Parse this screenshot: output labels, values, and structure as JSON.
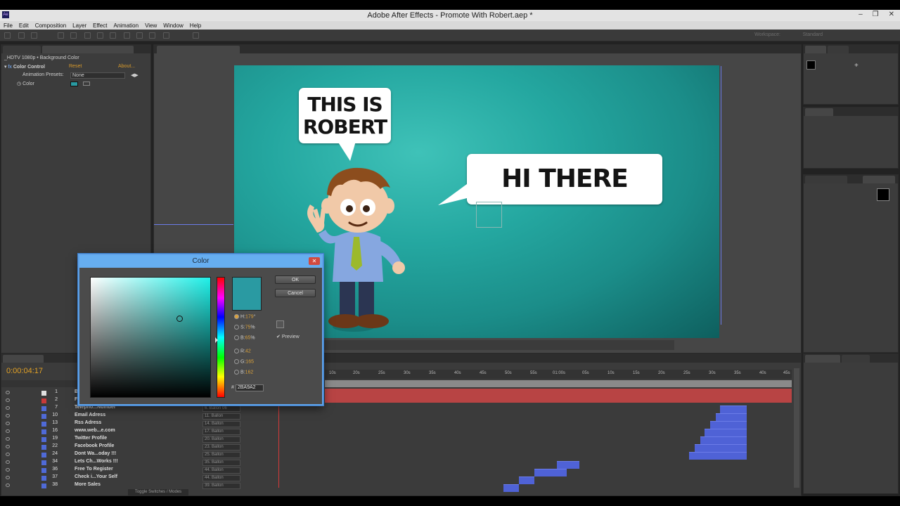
{
  "window": {
    "title": "Adobe After Effects - Promote With Robert.aep *",
    "app_icon": "Ae"
  },
  "menu": [
    "File",
    "Edit",
    "Composition",
    "Layer",
    "Effect",
    "Animation",
    "View",
    "Window",
    "Help"
  ],
  "effect_controls": {
    "breadcrumb": "_HDTV 1080p • Background Color",
    "effect_name": "Color Control",
    "reset": "Reset",
    "about": "About...",
    "presets_label": "Animation Presets:",
    "presets_value": "None",
    "color_label": "Color",
    "color_value": "#2A9AA2"
  },
  "canvas": {
    "bubble_left": [
      "THIS IS",
      "ROBERT"
    ],
    "bubble_right": "HI THERE"
  },
  "color_dialog": {
    "title": "Color",
    "ok": "OK",
    "cancel": "Cancel",
    "h_label": "H:",
    "h_value": "179",
    "h_unit": "°",
    "s_label": "S:",
    "s_value": "75",
    "s_unit": "%",
    "b_label": "B:",
    "b_value": "65",
    "b_unit": "%",
    "r_label": "R:",
    "r_value": "42",
    "g_label": "G:",
    "g_value": "165",
    "bl_label": "B:",
    "bl_value": "162",
    "hex_label": "#",
    "hex_value": "2BA9A2",
    "preview_label": "Preview",
    "preview_checked": true,
    "swatch_color": "#2a9aa2"
  },
  "timeline": {
    "timecode": "0:00:04:17",
    "ruler": [
      "10s",
      "20s",
      "25s",
      "30s",
      "35s",
      "40s",
      "45s",
      "50s",
      "55s",
      "01:00s",
      "05s",
      "10s",
      "15s",
      "20s",
      "25s",
      "30s",
      "35s",
      "40s",
      "45s"
    ],
    "toggle_label": "Toggle Switches / Modes",
    "layers": [
      {
        "num": "1",
        "name": "B",
        "parent": ""
      },
      {
        "num": "2",
        "name": "Fo",
        "parent": ""
      },
      {
        "num": "7",
        "name": "Telepho...Number",
        "parent": "6. Ballon 06"
      },
      {
        "num": "10",
        "name": "Email Adress",
        "parent": "11. Ballon"
      },
      {
        "num": "13",
        "name": "Rss Adress",
        "parent": "14. Ballon"
      },
      {
        "num": "16",
        "name": "www.web...e.com",
        "parent": "17. Ballon"
      },
      {
        "num": "19",
        "name": "Twitter Profile",
        "parent": "20. Ballon"
      },
      {
        "num": "22",
        "name": "Facebook Profile",
        "parent": "23. Ballon"
      },
      {
        "num": "24",
        "name": "Dont Wa...oday !!!",
        "parent": "25. Ballon"
      },
      {
        "num": "34",
        "name": "Lets Ch...Works !!!",
        "parent": "35. Ballon"
      },
      {
        "num": "36",
        "name": "Free To Register",
        "parent": "44. Ballon"
      },
      {
        "num": "37",
        "name": "Check i...Your Self",
        "parent": "44. Ballon"
      },
      {
        "num": "38",
        "name": "More Sales",
        "parent": "39. Ballon"
      }
    ]
  },
  "colors": {
    "accent": "#66aef0",
    "teal": "#2a9aa2",
    "layer_bar": "#4f62d6",
    "red_bar": "#b84444"
  }
}
